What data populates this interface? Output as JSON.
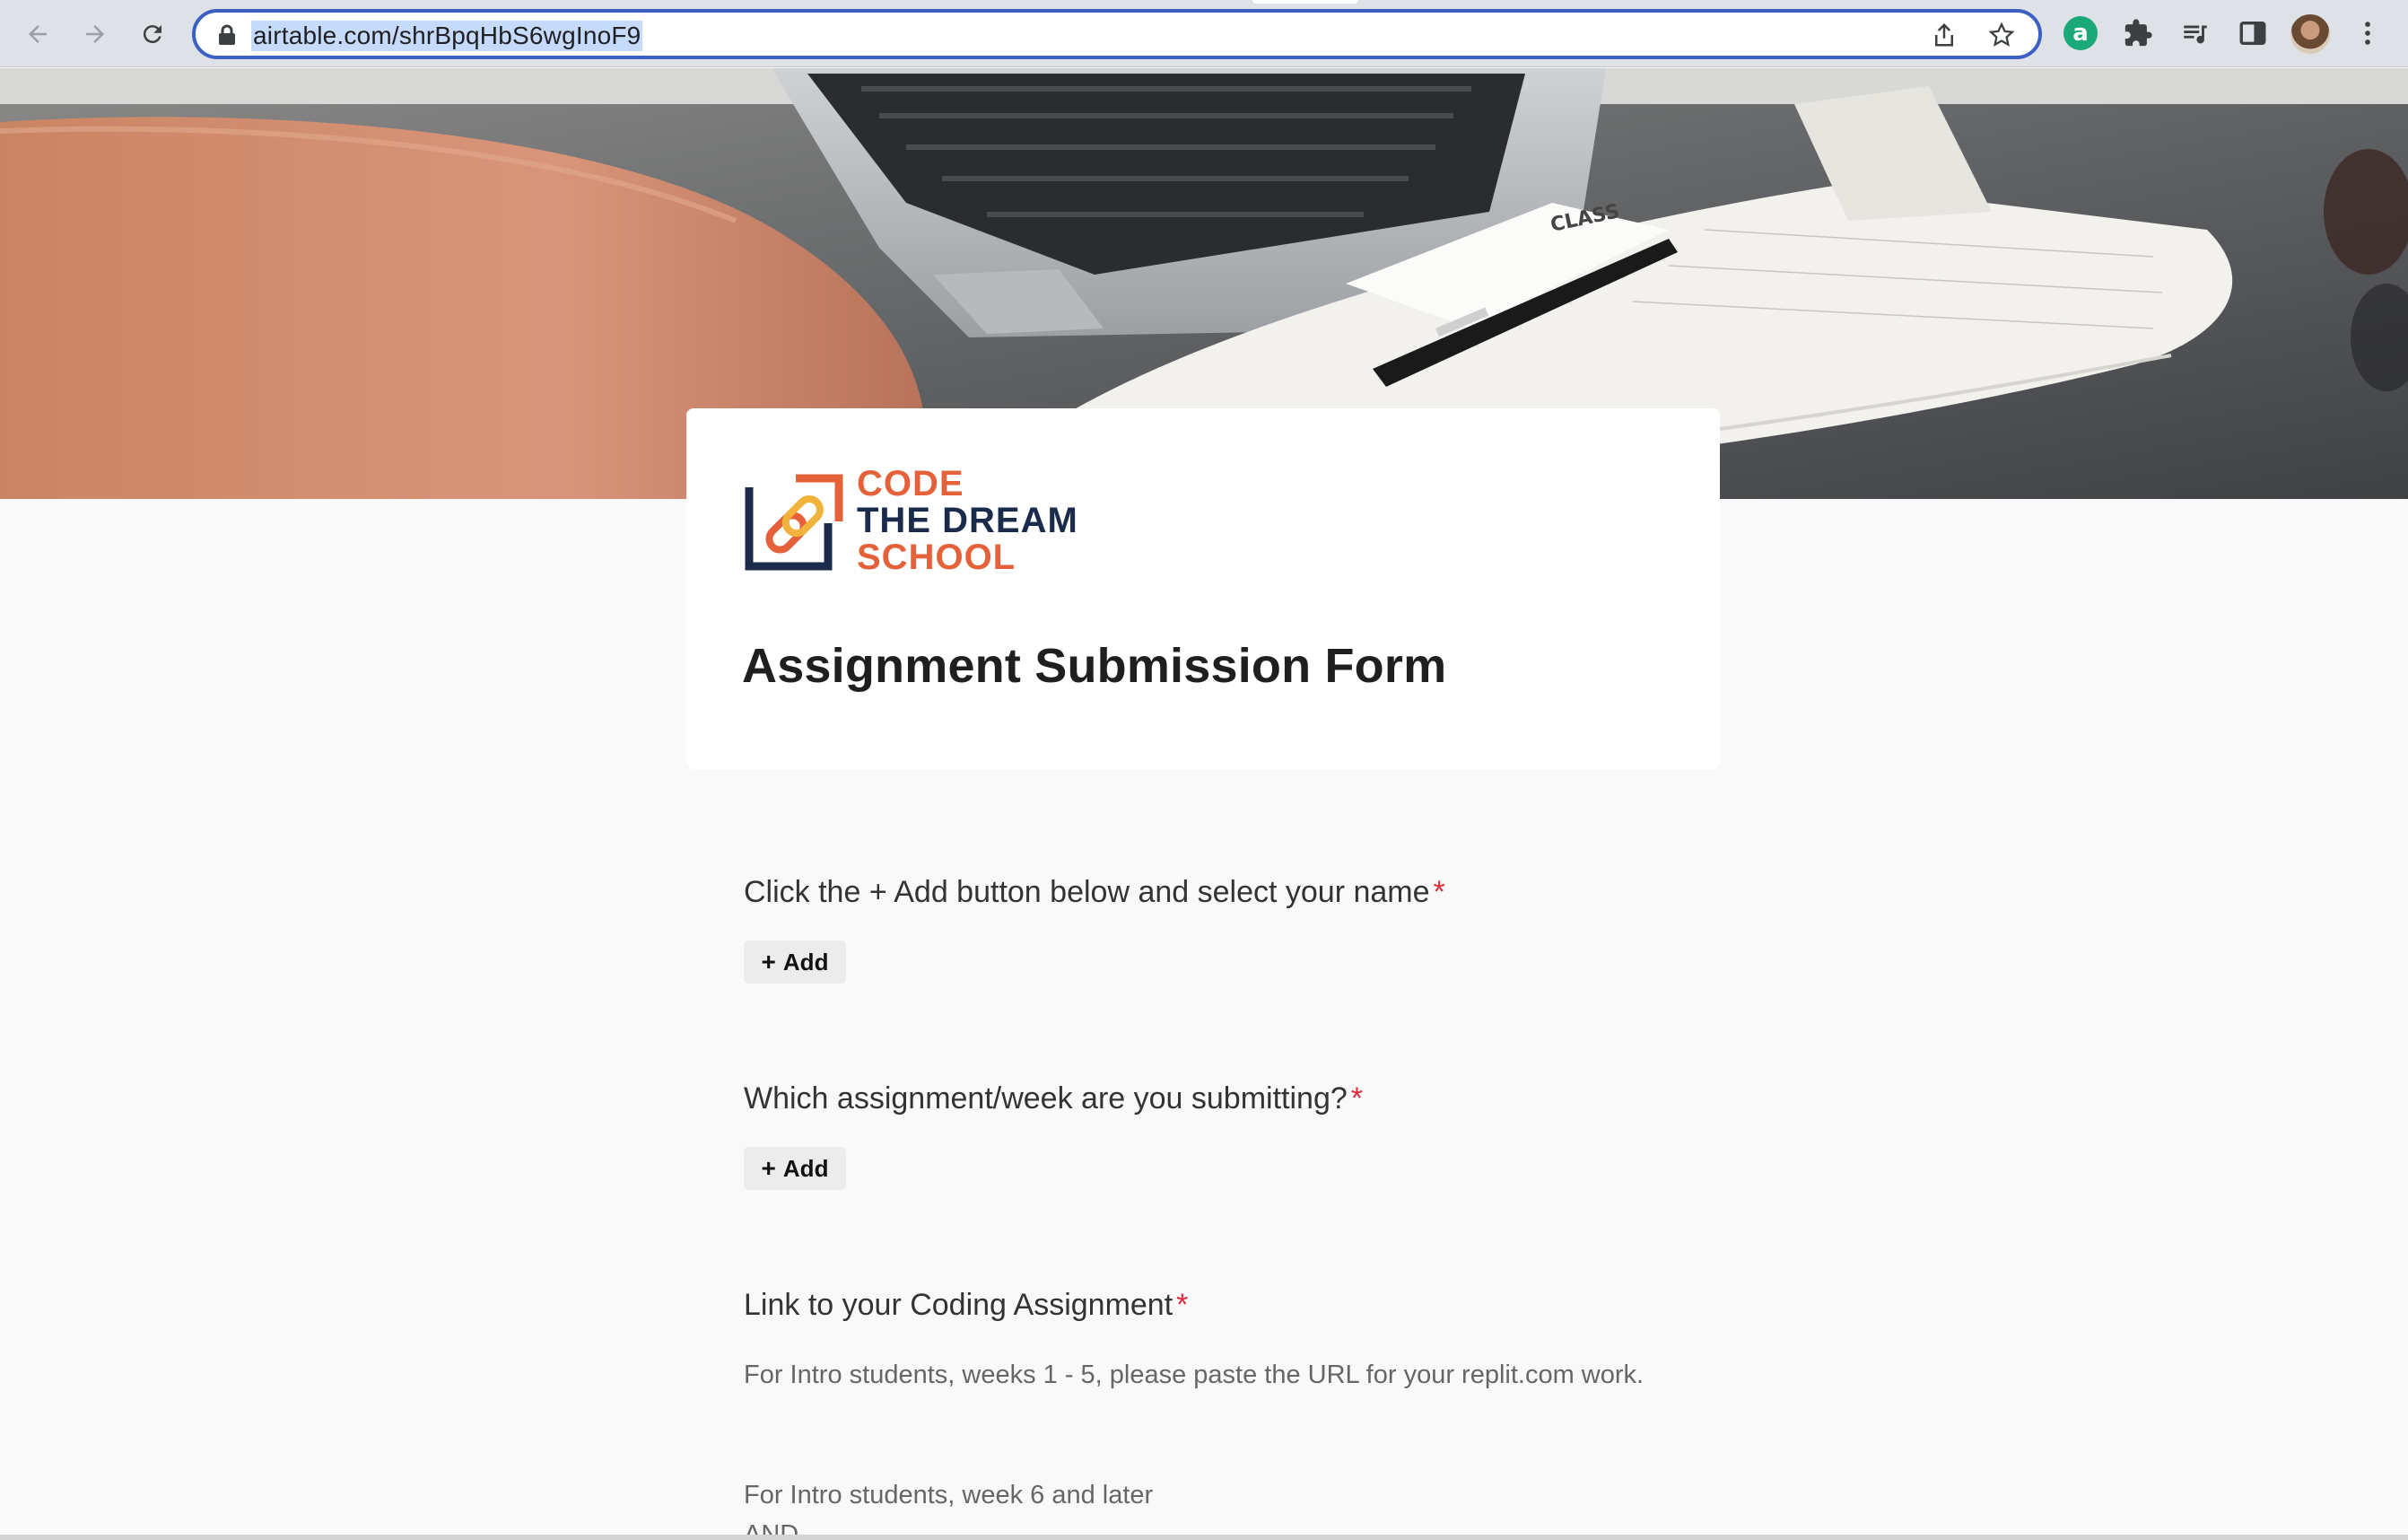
{
  "browser": {
    "url": "airtable.com/shrBpqHbS6wgInoF9",
    "extension_a_label": "a"
  },
  "header": {
    "logo_line1": "CODE",
    "logo_line2": "THE DREAM",
    "logo_line3": "SCHOOL",
    "title": "Assignment Submission Form"
  },
  "fields": [
    {
      "label": "Click the + Add button below and select your name",
      "required": "*",
      "button": "Add"
    },
    {
      "label": "Which assignment/week are you submitting?",
      "required": "*",
      "button": "Add"
    },
    {
      "label": "Link to your Coding Assignment",
      "required": "*",
      "help": [
        "For Intro students, weeks 1 - 5, please paste the URL for your replit.com work.",
        "For Intro students, week 6 and later",
        "AND"
      ]
    }
  ],
  "colors": {
    "accent_orange": "#e4613a",
    "navy": "#1b2b4b",
    "required_red": "#e0293a",
    "omnibox_focus": "#3c5fc4"
  },
  "icons": [
    "back-arrow-icon",
    "forward-arrow-icon",
    "reload-icon",
    "lock-icon",
    "share-icon",
    "star-icon",
    "puzzle-icon",
    "media-queue-icon",
    "side-panel-icon",
    "kebab-menu-icon",
    "plus-icon"
  ]
}
